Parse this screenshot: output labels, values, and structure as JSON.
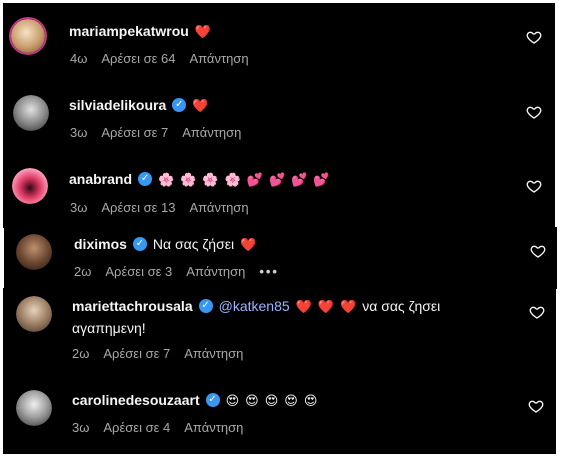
{
  "comments": [
    {
      "username": "mariampekatwrou",
      "verified": false,
      "text": "",
      "emojis": [
        "❤️"
      ],
      "age": "4ω",
      "likes": "Αρέσει σε 64",
      "reply": "Απάντηση",
      "avatar": {
        "from": "#f3d9b5",
        "to": "#b08b63"
      }
    },
    {
      "username": "silviadelikoura",
      "verified": true,
      "text": "",
      "emojis": [
        "❤️"
      ],
      "age": "3ω",
      "likes": "Αρέσει σε 7",
      "reply": "Απάντηση",
      "avatar": {
        "from": "#d8d8d8",
        "to": "#555555"
      }
    },
    {
      "username": "anabrand",
      "verified": true,
      "text": "",
      "emojis": [
        "🌸",
        "🌸",
        "🌸",
        "🌸",
        "💕",
        "💕",
        "💕",
        "💕"
      ],
      "age": "3ω",
      "likes": "Αρέσει σε 13",
      "reply": "Απάντηση",
      "avatar": {
        "from": "#ff8fb1",
        "to": "#d9345f"
      }
    },
    {
      "username": "diximos",
      "verified": true,
      "text": "Να σας ζήσει",
      "emojis": [
        "❤️"
      ],
      "age": "2ω",
      "likes": "Αρέσει σε 3",
      "reply": "Απάντηση",
      "more": "•••",
      "avatar": {
        "from": "#8a6a4f",
        "to": "#2d1f16"
      }
    },
    {
      "username": "mariettachrousala",
      "verified": true,
      "mention": "@katken85",
      "emojis": [
        "❤️",
        "❤️",
        "❤️"
      ],
      "text_after": "να σας ζησει",
      "text_line2": "αγαπημενη!",
      "age": "2ω",
      "likes": "Αρέσει σε 7",
      "reply": "Απάντηση",
      "avatar": {
        "from": "#c9b29a",
        "to": "#5a4636"
      }
    },
    {
      "username": "carolinedesouzaart",
      "verified": true,
      "text": "",
      "emojis": [
        "😍",
        "😍",
        "😍",
        "😍",
        "😍"
      ],
      "age": "3ω",
      "likes": "Αρέσει σε 4",
      "reply": "Απάντηση",
      "avatar": {
        "from": "#e6e6e6",
        "to": "#6b6b6b"
      }
    }
  ],
  "colors": {
    "background": "#000000",
    "username": "#f5f5f5",
    "meta": "#a8a8a8",
    "verified": "#3897f0",
    "mention": "#a0b4ff",
    "story_ring": "#c13584"
  },
  "icons": {
    "verified": "check-badge-icon",
    "like": "heart-outline-icon",
    "more": "more-horizontal-icon"
  }
}
